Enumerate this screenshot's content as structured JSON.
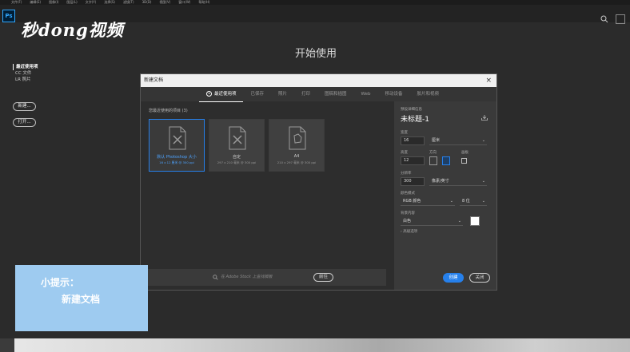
{
  "menubar": {
    "items": [
      "文件(F)",
      "编辑(E)",
      "图像(I)",
      "图层(L)",
      "文字(Y)",
      "选择(S)",
      "滤镜(T)",
      "3D(D)",
      "视图(V)",
      "窗口(W)",
      "帮助(H)"
    ]
  },
  "app": {
    "logo": "Ps",
    "watermark": "秒dong视频",
    "accent": "#2680eb"
  },
  "welcome": {
    "title": "开始使用"
  },
  "sidebar": {
    "items": [
      {
        "label": "最近使用项"
      },
      {
        "label": "CC 文件"
      },
      {
        "label": "LR 照片"
      }
    ],
    "new_label": "新建...",
    "open_label": "打开..."
  },
  "dialog": {
    "title": "新建文档",
    "tabs": [
      "最近使用项",
      "已保存",
      "照片",
      "打印",
      "图稿和插图",
      "Web",
      "移动设备",
      "胶片和视频"
    ],
    "presets_label": "您最近使用的项目 (3)",
    "presets": [
      {
        "name": "默认 Photoshop 大小",
        "desc": "16 x 12 厘米 @ 300 ppi"
      },
      {
        "name": "自定",
        "desc": "297 x 210 毫米 @ 300 ppi"
      },
      {
        "name": "A4",
        "desc": "210 x 297 毫米 @ 300 ppi"
      }
    ],
    "stock_placeholder": "在 Adobe Stock 上查找模板",
    "stock_button": "前往",
    "details": {
      "section_label": "预设详细信息",
      "doc_name": "未标题-1",
      "width_label": "宽度",
      "width_value": "16",
      "width_unit": "厘米",
      "height_label": "高度",
      "height_value": "12",
      "orientation_label": "方向",
      "artboard_label": "画板",
      "resolution_label": "分辨率",
      "resolution_value": "300",
      "resolution_unit": "像素/英寸",
      "color_mode_label": "颜色模式",
      "color_mode": "RGB 颜色",
      "bit_depth": "8 位",
      "background_label": "背景内容",
      "background": "白色",
      "advanced_label": "高级选项"
    },
    "create_button": "创建",
    "close_button": "关闭"
  },
  "hint": {
    "title": "小提示：",
    "body": "新建文档"
  }
}
